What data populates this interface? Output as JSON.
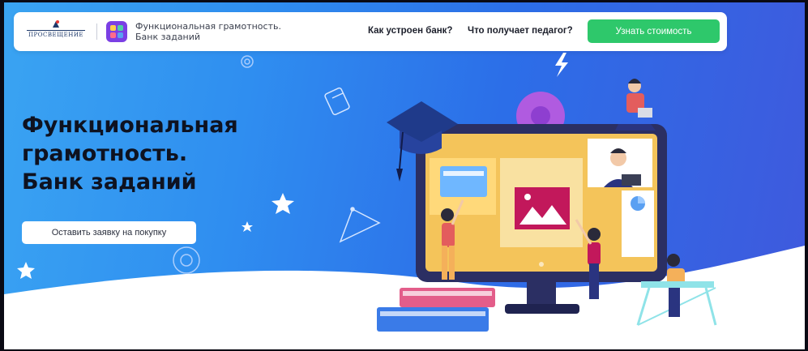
{
  "header": {
    "publisher_logo_text": "ПРОСВЕЩЕНИЕ",
    "brand_line1": "Функциональная грамотность.",
    "brand_line2": "Банк заданий",
    "nav": [
      {
        "label": "Как устроен банк?"
      },
      {
        "label": "Что получает педагог?"
      }
    ],
    "cta_label": "Узнать стоимость"
  },
  "hero": {
    "title_lines": [
      "Функциональная",
      "грамотность.",
      "Банк заданий"
    ],
    "order_button_label": "Оставить заявку на покупку"
  },
  "colors": {
    "hero_blue": "#2f8ef0",
    "cta_green": "#2ec86b",
    "app_icon_purple": "#7b3fe4",
    "title_text": "#0e1220"
  },
  "icons": [
    "gear-icon",
    "lightning-icon",
    "book-icon",
    "star-icon",
    "triangle-icon",
    "graduation-cap-icon",
    "image-icon",
    "pie-chart-icon",
    "laptop-icon"
  ]
}
